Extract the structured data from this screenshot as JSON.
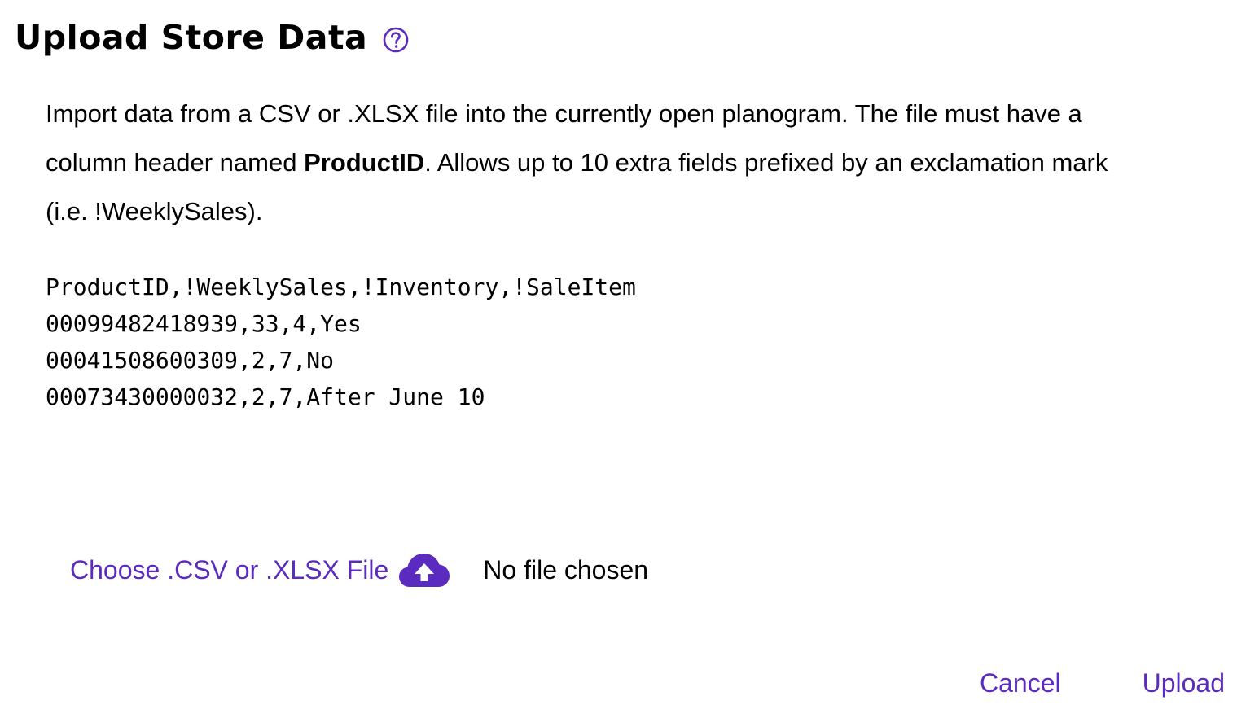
{
  "colors": {
    "accent": "#5b2bbf"
  },
  "dialog": {
    "title": "Upload Store Data",
    "help_icon": "question-circle-icon",
    "description": {
      "part1": "Import data from a CSV or .XLSX file into the currently open planogram. The file must have a column header named ",
      "bold": "ProductID",
      "part2": ". Allows up to 10 extra fields prefixed by an exclamation mark (i.e. !WeeklySales)."
    },
    "sample_lines": [
      "ProductID,!WeeklySales,!Inventory,!SaleItem",
      "00099482418939,33,4,Yes",
      "00041508600309,2,7,No",
      "00073430000032,2,7,After June 10"
    ],
    "file_picker": {
      "choose_label": "Choose .CSV or .XLSX File",
      "icon": "cloud-upload-icon",
      "status": "No file chosen"
    },
    "actions": {
      "cancel": "Cancel",
      "upload": "Upload"
    }
  }
}
